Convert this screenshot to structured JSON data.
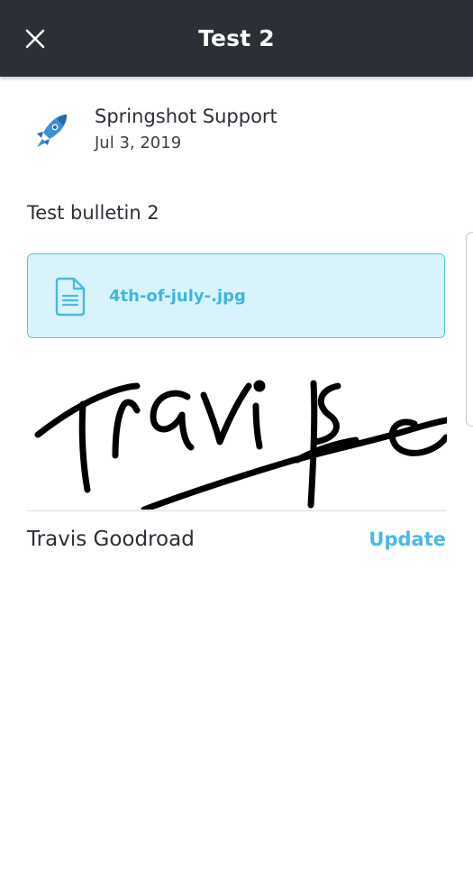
{
  "header": {
    "title": "Test 2",
    "close_icon": "close-icon"
  },
  "post": {
    "author": "Springshot Support",
    "date": "Jul 3, 2019",
    "avatar_icon": "rocket-icon",
    "body": "Test bulletin 2",
    "attachment": {
      "file_name": "4th-of-july-.jpg",
      "icon": "document-icon"
    }
  },
  "signature": {
    "signer": "Travis Goodroad",
    "update_label": "Update"
  },
  "colors": {
    "header_bg": "#2c2f36",
    "accent": "#4ab9e3",
    "attachment_bg": "#d8f3fb",
    "attachment_border": "#5cc3e6"
  }
}
